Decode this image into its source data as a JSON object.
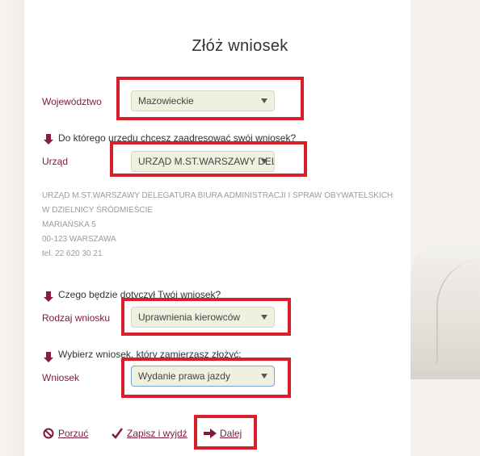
{
  "title": "Złóż wniosek",
  "fields": {
    "wojewodztwo": {
      "label": "Województwo",
      "value": "Mazowieckie"
    },
    "urzad": {
      "hint": "Do którego urzędu chcesz zaadresować swój wniosek?",
      "label": "Urząd",
      "value": "URZĄD M.ST.WARSZAWY DELEGATURA"
    },
    "rodzaj": {
      "hint": "Czego będzie dotyczył Twój wniosek?",
      "label": "Rodzaj wniosku",
      "value": "Uprawnienia kierowców"
    },
    "wniosek": {
      "hint": "Wybierz wniosek, który zamierzasz złożyć:",
      "label": "Wniosek",
      "value": "Wydanie prawa jazdy"
    }
  },
  "address": {
    "line1": "URZĄD M.ST.WARSZAWY DELEGATURA BIURA ADMINISTRACJI I SPRAW OBYWATELSKICH",
    "line2": "W DZIELNICY ŚRÓDMIEŚCIE",
    "line3": "MARIAŃSKA 5",
    "line4": "00-123 WARSZAWA",
    "line5": "tel. 22 620 30 21"
  },
  "actions": {
    "cancel": "Porzuć",
    "save": "Zapisz i wyjdź",
    "next": "Dalej"
  },
  "colors": {
    "accent": "#7a1c3a",
    "highlight": "#d81f2a",
    "select_bg": "#eef0e0"
  }
}
